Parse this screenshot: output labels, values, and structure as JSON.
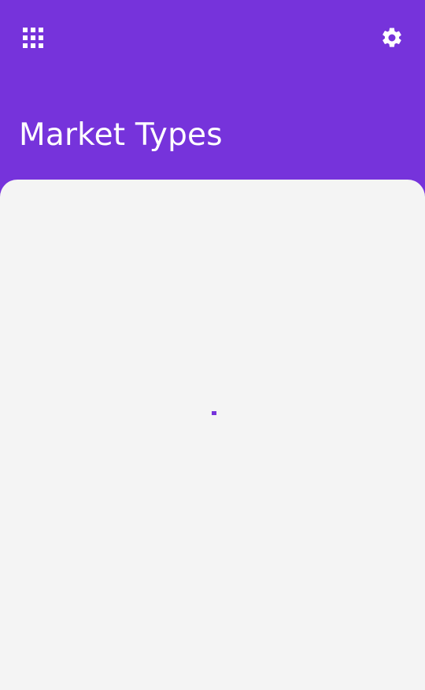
{
  "header": {
    "title": "Market Types",
    "apps_icon": "apps-grid-icon",
    "settings_icon": "gear-icon"
  },
  "colors": {
    "primary": "#7633db",
    "surface": "#f4f4f4",
    "on_primary": "#ffffff"
  },
  "content": {
    "state": "loading"
  }
}
